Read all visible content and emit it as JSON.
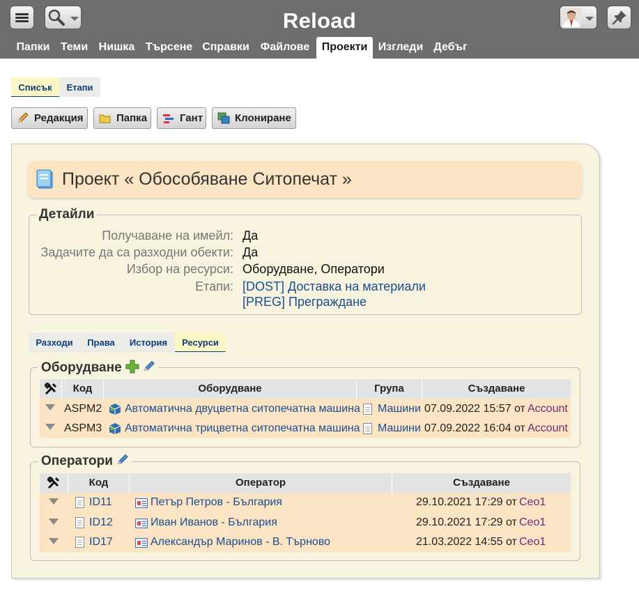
{
  "header": {
    "title": "Reload",
    "nav": [
      "Папки",
      "Теми",
      "Нишка",
      "Търсене",
      "Справки",
      "Файлове",
      "Проекти",
      "Изгледи",
      "Дебъг"
    ],
    "active_nav": "Проекти"
  },
  "subtabs": [
    "Списък",
    "Етапи"
  ],
  "actions": [
    "Редакция",
    "Папка",
    "Гант",
    "Клониране"
  ],
  "project": {
    "title": "Проект « Обособяване Ситопечат »"
  },
  "details": {
    "legend": "Детайли",
    "rows": [
      {
        "label": "Получаване на имейл:",
        "value": "Да"
      },
      {
        "label": "Задачите да са разходни обекти:",
        "value": "Да"
      },
      {
        "label": "Избор на ресурси:",
        "value": "Оборудване, Оператори"
      },
      {
        "label": "Етапи:",
        "links": [
          "[DOST] Доставка на материали",
          "[PREG] Преграждане"
        ]
      }
    ]
  },
  "inner_tabs": [
    "Разходи",
    "Права",
    "История",
    "Ресурси"
  ],
  "active_inner_tab": "Ресурси",
  "equipment": {
    "legend": "Оборудване",
    "columns": [
      "Код",
      "Оборудване",
      "Група",
      "Създаване"
    ],
    "rows": [
      {
        "code": "ASPM2",
        "name": "Автоматична двуцветна ситопечатна машина",
        "group": "Машини",
        "created": "07.09.2022 15:57 от",
        "by": "Account"
      },
      {
        "code": "ASPM3",
        "name": "Автоматична трицветна ситопечатна машина",
        "group": "Машини",
        "created": "07.09.2022 16:04 от",
        "by": "Account"
      }
    ]
  },
  "operators": {
    "legend": "Оператори",
    "columns": [
      "Код",
      "Оператор",
      "Създаване"
    ],
    "rows": [
      {
        "code": "ID11",
        "name": "Петър Петров - България",
        "created": "29.10.2021 17:29 от",
        "by": "Ceo1"
      },
      {
        "code": "ID12",
        "name": "Иван Иванов - България",
        "created": "29.10.2021 17:29 от",
        "by": "Ceo1"
      },
      {
        "code": "ID17",
        "name": "Александър Маринов - В. Търново",
        "created": "21.03.2022 14:55 от",
        "by": "Ceo1"
      }
    ]
  },
  "colors": {
    "header_bg": "#6d6d6d",
    "panel_bg": "#f7f3df",
    "row_bg": "#fae4c4",
    "link": "#1a4d8f",
    "account_link": "#6e2a7a"
  }
}
